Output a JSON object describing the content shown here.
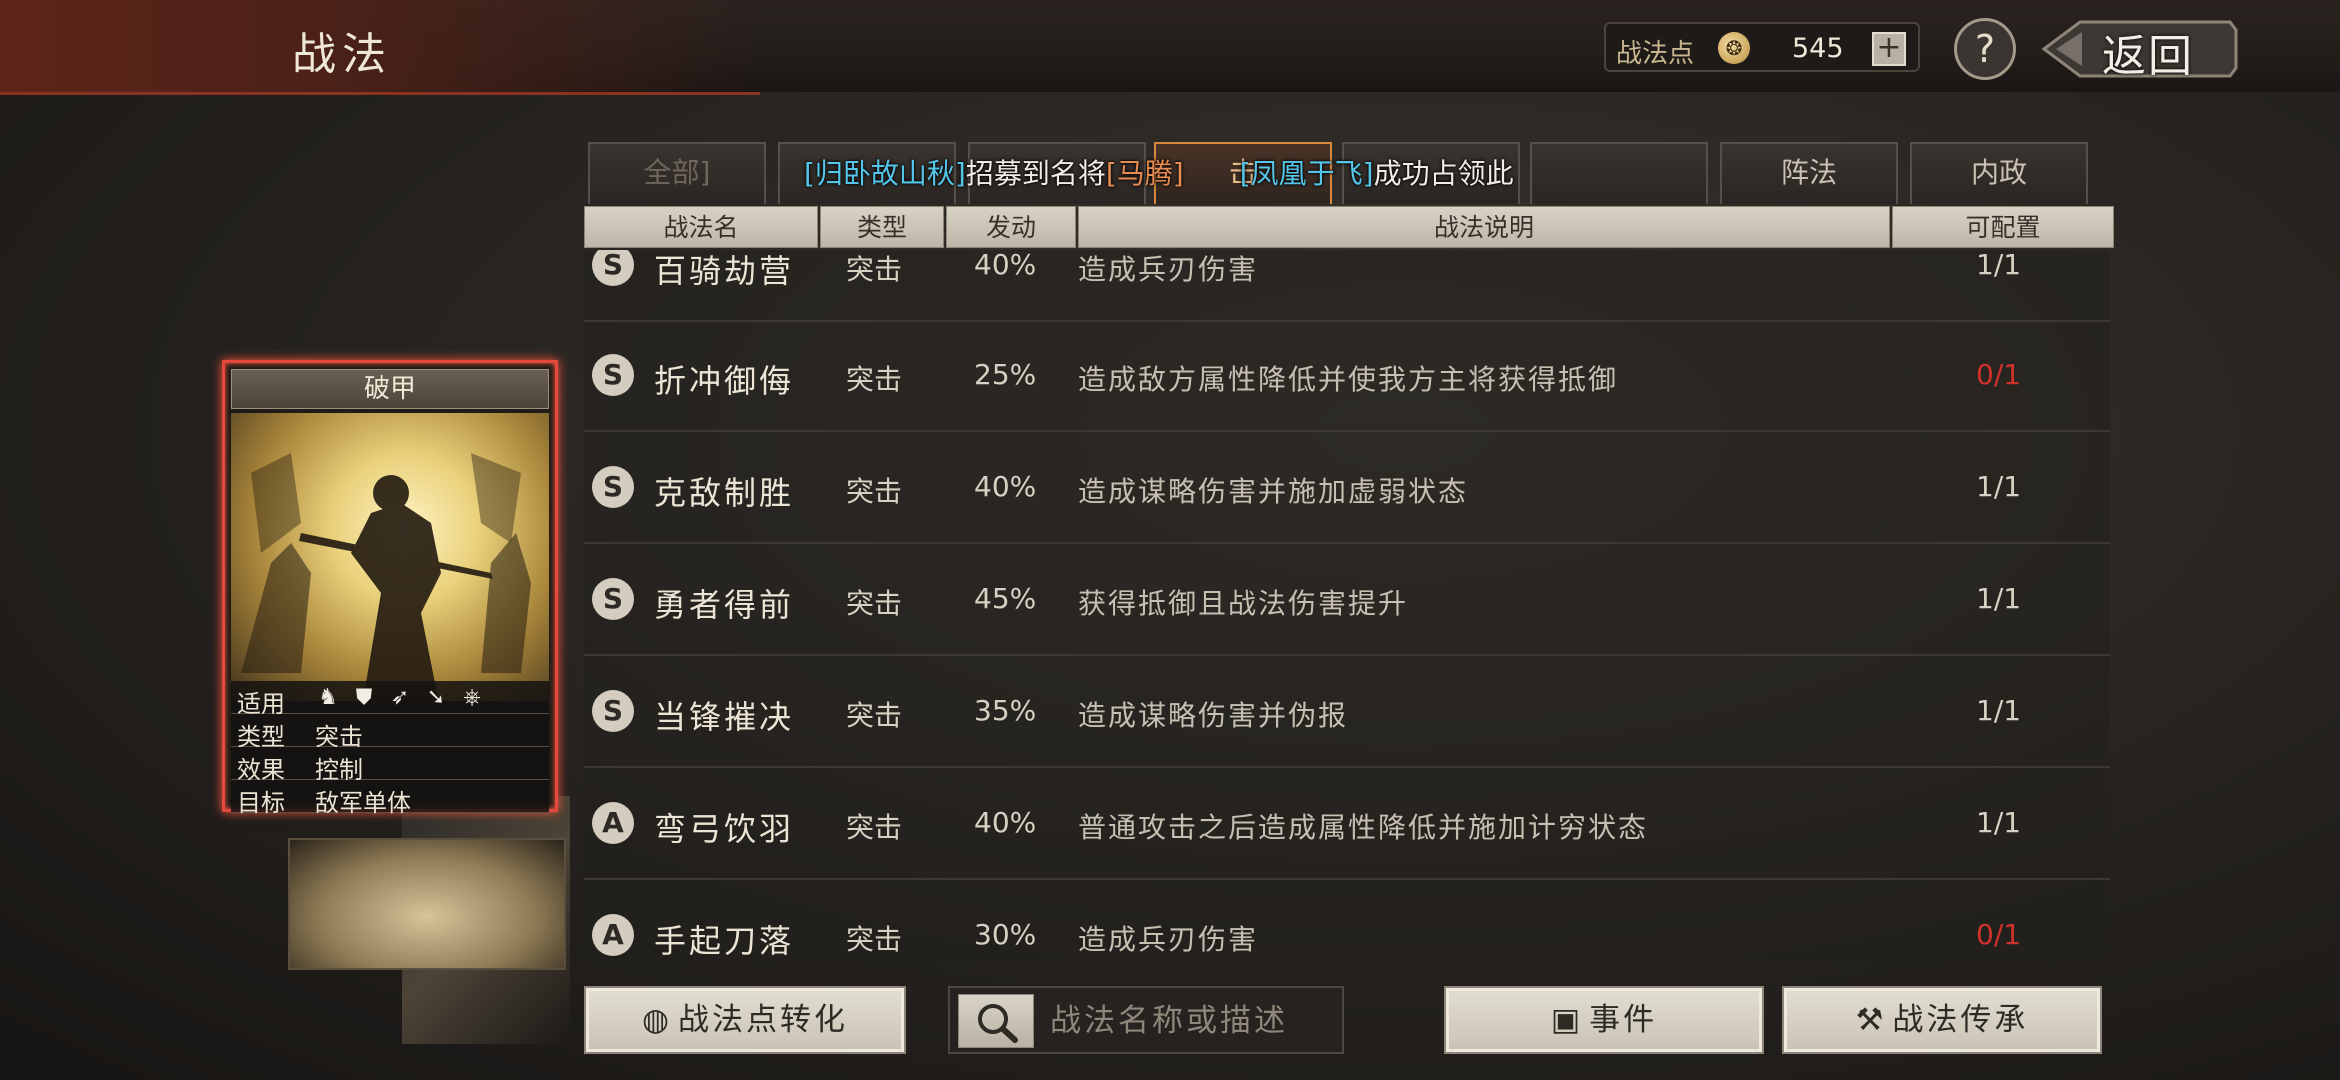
{
  "header": {
    "title": "战法",
    "points_label": "战法点",
    "points_value": "545",
    "plus_label": "+",
    "help_label": "?",
    "back_label": "返回"
  },
  "tabs": [
    {
      "label": "全部]",
      "state": "dim"
    },
    {
      "label": "",
      "state": "dim"
    },
    {
      "label": "",
      "state": "dim"
    },
    {
      "label": "击",
      "state": "active"
    },
    {
      "label": "",
      "state": "dim"
    },
    {
      "label": "",
      "state": "dim"
    },
    {
      "label": "",
      "state": "dim"
    },
    {
      "label": "阵法",
      "state": "normal"
    },
    {
      "label": "内政",
      "state": "normal"
    }
  ],
  "banner": {
    "part1": "[归卧故山秋]",
    "part2": "招募到名将",
    "part3": "[马腾]",
    "part4": "[凤凰于飞]",
    "part5": "成功占领此"
  },
  "table": {
    "headers": [
      "战法名",
      "类型",
      "发动",
      "战法说明",
      "可配置"
    ],
    "rows": [
      {
        "grade": "S",
        "name": "百骑劫营",
        "type": "突击",
        "rate": "40%",
        "desc": "造成兵刃伤害",
        "avail": "1/1",
        "avail_red": false
      },
      {
        "grade": "S",
        "name": "折冲御侮",
        "type": "突击",
        "rate": "25%",
        "desc": "造成敌方属性降低并使我方主将获得抵御",
        "avail": "0/1",
        "avail_red": true
      },
      {
        "grade": "S",
        "name": "克敌制胜",
        "type": "突击",
        "rate": "40%",
        "desc": "造成谋略伤害并施加虚弱状态",
        "avail": "1/1",
        "avail_red": false
      },
      {
        "grade": "S",
        "name": "勇者得前",
        "type": "突击",
        "rate": "45%",
        "desc": "获得抵御且战法伤害提升",
        "avail": "1/1",
        "avail_red": false
      },
      {
        "grade": "S",
        "name": "当锋摧决",
        "type": "突击",
        "rate": "35%",
        "desc": "造成谋略伤害并伪报",
        "avail": "1/1",
        "avail_red": false
      },
      {
        "grade": "A",
        "name": "弯弓饮羽",
        "type": "突击",
        "rate": "40%",
        "desc": "普通攻击之后造成属性降低并施加计穷状态",
        "avail": "1/1",
        "avail_red": false
      },
      {
        "grade": "A",
        "name": "手起刀落",
        "type": "突击",
        "rate": "30%",
        "desc": "造成兵刃伤害",
        "avail": "0/1",
        "avail_red": true
      }
    ]
  },
  "card": {
    "title": "破甲",
    "rows": [
      {
        "label": "适用",
        "value": ""
      },
      {
        "label": "类型",
        "value": "突击"
      },
      {
        "label": "效果",
        "value": "控制"
      },
      {
        "label": "目标",
        "value": "敌军单体"
      }
    ],
    "unit_icons": [
      "cavalry-icon",
      "shield-icon",
      "bow-icon",
      "spear-icon",
      "chariot-icon"
    ]
  },
  "bottom": {
    "convert_label": "战法点转化",
    "search_placeholder": "战法名称或描述",
    "events_label": "事件",
    "inherit_label": "战法传承"
  },
  "colors": {
    "active_tab_border": "#d9883f",
    "card_highlight": "#e5483c",
    "unavailable": "#d0312b",
    "banner_highlight": "#55c6e9"
  }
}
